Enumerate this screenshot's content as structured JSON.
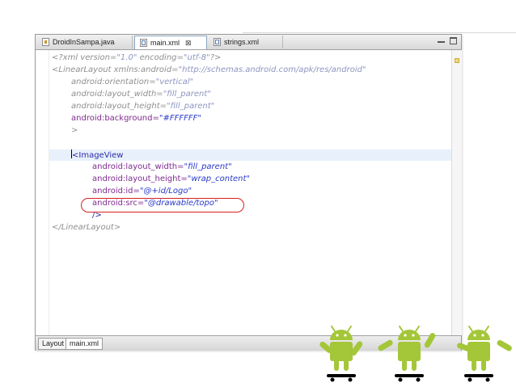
{
  "tabs": [
    {
      "label": "DroidInSampa.java",
      "type": "java",
      "active": false
    },
    {
      "label": "main.xml",
      "type": "xml",
      "active": true,
      "close": "⊠"
    },
    {
      "label": "strings.xml",
      "type": "xml",
      "active": false
    }
  ],
  "code": {
    "l1": {
      "a": "<?xml version=",
      "b": "\"1.0\"",
      "c": " encoding=",
      "d": "\"utf-8\"",
      "e": "?>"
    },
    "l2": {
      "a": "<LinearLayout xmlns:android=",
      "b": "\"http://schemas.android.com/apk/res/android\""
    },
    "l3": {
      "a": "android:orientation=",
      "b": "\"vertical\""
    },
    "l4": {
      "a": "android:layout_width=",
      "b": "\"fill_parent\""
    },
    "l5": {
      "a": "android:layout_height=",
      "b": "\"fill_parent\""
    },
    "l6": {
      "a": "android:background=",
      "b": "\"#FFFFFF\""
    },
    "l7": {
      "a": ">"
    },
    "l8": {
      "a": "<ImageView"
    },
    "l9": {
      "a": "android:layout_width=",
      "b": "\"fill_parent\""
    },
    "l10": {
      "a": "android:layout_height=",
      "b": "\"wrap_content\""
    },
    "l11": {
      "a": "android:id=",
      "b": "\"@+id/Logo\""
    },
    "l12": {
      "a": "android:src=",
      "b": "\"@drawable/topo\""
    },
    "l13": {
      "a": "/>"
    },
    "l14": {
      "a": "</LinearLayout>"
    }
  },
  "bottom_tabs": [
    {
      "label": "Layout",
      "active": false
    },
    {
      "label": "main.xml",
      "active": true
    }
  ],
  "colors": {
    "robot_green": "#a4c639",
    "highlight_oval": "#d62020"
  },
  "decoration": {
    "icon": "android-robot-skateboard-icon",
    "count": 3
  }
}
